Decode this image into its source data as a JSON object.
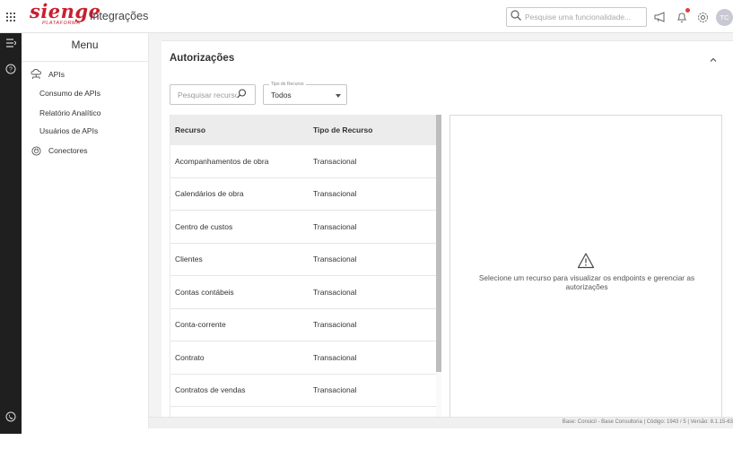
{
  "header": {
    "logo_text": "sienge",
    "logo_sub": "PLATAFORMA",
    "app_title": "Integrações",
    "search_placeholder": "Pesquise uma funcionalidade...",
    "avatar_initials": "TC"
  },
  "menu": {
    "title": "Menu",
    "items": [
      {
        "label": "APIs",
        "icon": "cloud-network-icon",
        "level": 0
      },
      {
        "label": "Consumo de APIs",
        "level": 1
      },
      {
        "label": "Relatório Analítico",
        "level": 1
      },
      {
        "label": "Usuários de APIs",
        "level": 1
      },
      {
        "label": "Conectores",
        "icon": "connector-icon",
        "level": 0
      }
    ]
  },
  "main": {
    "title": "Autorizações",
    "search_placeholder": "Pesquisar recurso",
    "filter": {
      "label": "Tipo de Recurso",
      "value": "Todos"
    },
    "table": {
      "columns": [
        "Recurso",
        "Tipo de Recurso"
      ],
      "rows": [
        [
          "Acompanhamentos de obra",
          "Transacional"
        ],
        [
          "Calendários de obra",
          "Transacional"
        ],
        [
          "Centro de custos",
          "Transacional"
        ],
        [
          "Clientes",
          "Transacional"
        ],
        [
          "Contas contábeis",
          "Transacional"
        ],
        [
          "Conta-corrente",
          "Transacional"
        ],
        [
          "Contrato",
          "Transacional"
        ],
        [
          "Contratos de vendas",
          "Transacional"
        ]
      ]
    },
    "detail_message": "Selecione um recurso para visualizar os endpoints e gerenciar as autorizações"
  },
  "footer": {
    "text": "Base: Consicil - Base Consultoria | Código: 1943 / 5 | Versão: 8.1.15-63"
  },
  "colors": {
    "brand": "#c8202f",
    "rail": "#1f1f1f",
    "content_bg": "#f3f3f3",
    "table_header_bg": "#ececec"
  }
}
